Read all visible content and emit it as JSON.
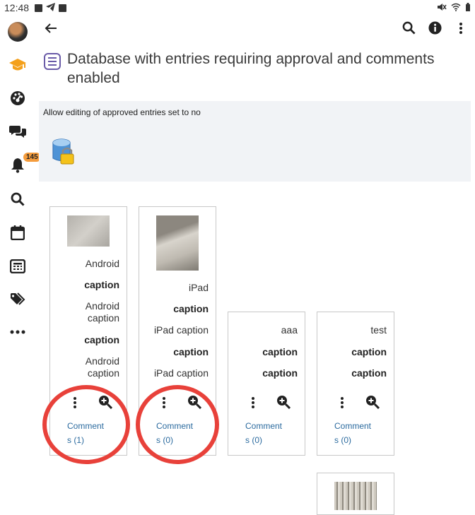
{
  "status_bar": {
    "time": "12:48"
  },
  "sidebar": {
    "notification_count": "145"
  },
  "page": {
    "title": "Database with entries requiring approval and comments enabled",
    "info_text": "Allow editing of approved entries set to no"
  },
  "entries": [
    {
      "rows": [
        {
          "text": "Android",
          "bold": false
        },
        {
          "text": "caption",
          "bold": true
        },
        {
          "text": "Android caption",
          "bold": false
        },
        {
          "text": "caption",
          "bold": true
        },
        {
          "text": "Android caption",
          "bold": false
        }
      ],
      "comments_label": "Comment s (1)",
      "comments_label_part1": "Comment",
      "comments_label_part2": "s (1)"
    },
    {
      "rows": [
        {
          "text": "iPad",
          "bold": false
        },
        {
          "text": "caption",
          "bold": true
        },
        {
          "text": "iPad caption",
          "bold": false
        },
        {
          "text": "caption",
          "bold": true
        },
        {
          "text": "iPad caption",
          "bold": false
        }
      ],
      "comments_label_part1": "Comment",
      "comments_label_part2": "s (0)"
    },
    {
      "rows": [
        {
          "text": "aaa",
          "bold": false
        },
        {
          "text": "caption",
          "bold": true
        },
        {
          "text": "caption",
          "bold": true
        }
      ],
      "comments_label_part1": "Comment",
      "comments_label_part2": "s (0)"
    },
    {
      "rows": [
        {
          "text": "test",
          "bold": false
        },
        {
          "text": "caption",
          "bold": true
        },
        {
          "text": "caption",
          "bold": true
        }
      ],
      "comments_label_part1": "Comment",
      "comments_label_part2": "s (0)"
    }
  ],
  "colors": {
    "link": "#2c6b9f",
    "annotation_circle": "#e8413a",
    "badge": "#f59c3c",
    "info_bg": "#f1f3f6"
  }
}
